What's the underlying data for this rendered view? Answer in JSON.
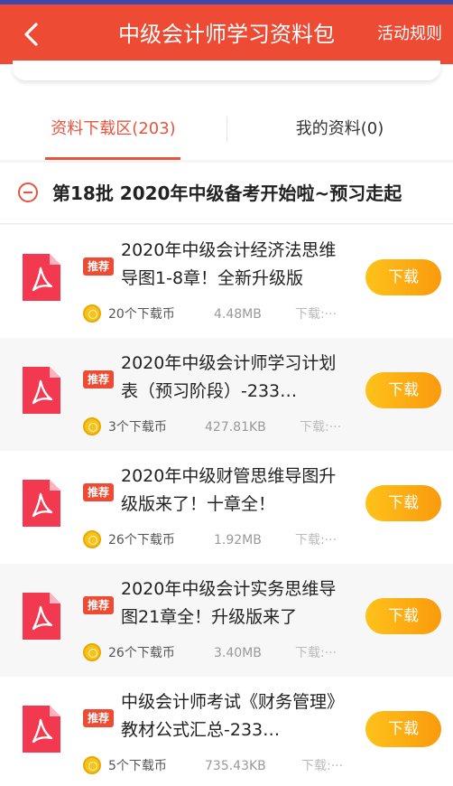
{
  "header": {
    "title": "中级会计师学习资料包",
    "action_label": "活动规则",
    "accent_color": "#ee4b34"
  },
  "tabs": [
    {
      "label": "资料下载区(203)",
      "active": true
    },
    {
      "label": "我的资料(0)",
      "active": false
    }
  ],
  "section": {
    "title": "第18批 2020年中级备考开始啦~预习走起",
    "icon": "minus-circle-icon"
  },
  "items": [
    {
      "badge": "推荐",
      "title": "2020年中级会计经济法思维导图1-8章！全新升级版",
      "coins": "20个下载币",
      "size": "4.48MB",
      "downloads": "下载:···",
      "button": "下载",
      "icon": "pdf-icon"
    },
    {
      "badge": "推荐",
      "title": "2020年中级会计师学习计划表（预习阶段）-233…",
      "coins": "3个下载币",
      "size": "427.81KB",
      "downloads": "下载:···",
      "button": "下载",
      "icon": "pdf-icon"
    },
    {
      "badge": "推荐",
      "title": "2020年中级财管思维导图升级版来了！十章全！",
      "coins": "26个下载币",
      "size": "1.92MB",
      "downloads": "下载:···",
      "button": "下载",
      "icon": "pdf-icon"
    },
    {
      "badge": "推荐",
      "title": "2020年中级会计实务思维导图21章全！升级版来了",
      "coins": "26个下载币",
      "size": "3.40MB",
      "downloads": "下载:···",
      "button": "下载",
      "icon": "pdf-icon"
    },
    {
      "badge": "推荐",
      "title": "中级会计师考试《财务管理》教材公式汇总-233…",
      "coins": "5个下载币",
      "size": "735.43KB",
      "downloads": "下载:···",
      "button": "下载",
      "icon": "pdf-icon"
    }
  ]
}
